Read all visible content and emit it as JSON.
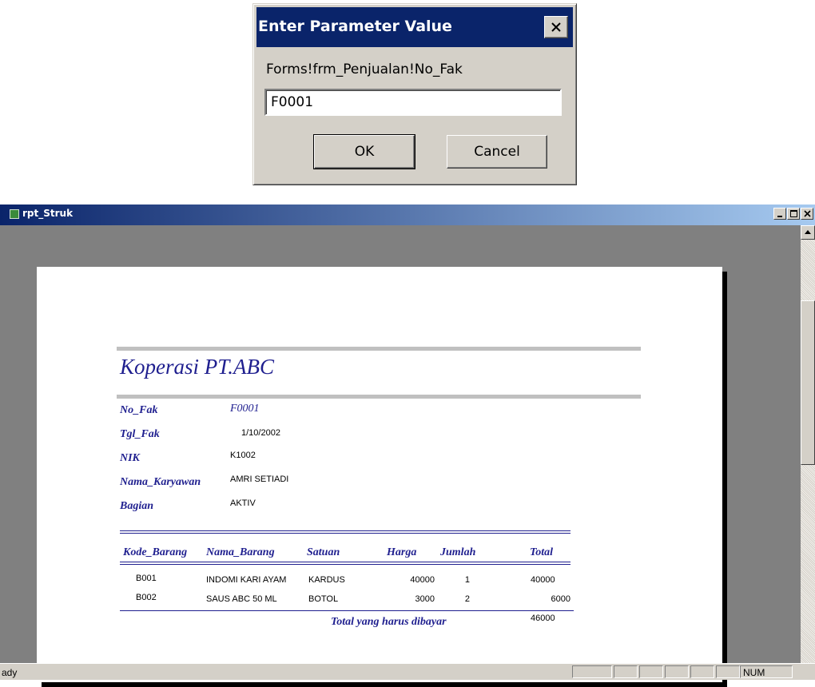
{
  "dialog": {
    "title": "Enter Parameter Value",
    "prompt": "Forms!frm_Penjualan!No_Fak",
    "input_value": "F0001",
    "ok_label": "OK",
    "cancel_label": "Cancel"
  },
  "window": {
    "title": "rpt_Struk"
  },
  "report": {
    "title": "Koperasi PT.ABC",
    "fields": [
      {
        "label": "No_Fak",
        "value": "F0001"
      },
      {
        "label": "Tgl_Fak",
        "value": "1/10/2002"
      },
      {
        "label": "NIK",
        "value": "K1002"
      },
      {
        "label": "Nama_Karyawan",
        "value": "AMRI SETIADI"
      },
      {
        "label": "Bagian",
        "value": "AKTIV"
      }
    ],
    "columns": [
      "Kode_Barang",
      "Nama_Barang",
      "Satuan",
      "Harga",
      "Jumlah",
      "Total"
    ],
    "rows": [
      [
        "B001",
        "INDOMI KARI AYAM",
        "KARDUS",
        "40000",
        "1",
        "40000"
      ],
      [
        "B002",
        "SAUS ABC 50 ML",
        "BOTOL",
        "3000",
        "2",
        "6000"
      ]
    ],
    "total_label": "Total yang harus dibayar",
    "total_value": "46000"
  },
  "status": {
    "text": "ady",
    "num": "NUM"
  },
  "colors": {
    "title_bar": "#0a246a",
    "report_text": "#1f1f8f",
    "workspace": "#808080"
  }
}
